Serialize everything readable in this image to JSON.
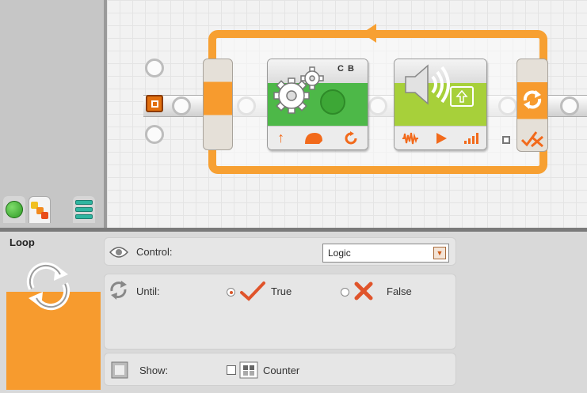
{
  "palette": {
    "tabs": [
      {
        "name": "common-palette",
        "icon": "green-circle-icon"
      },
      {
        "name": "complete-palette",
        "icon": "colored-squares-icon"
      },
      {
        "name": "custom-palette",
        "icon": "stacked-bars-icon"
      }
    ]
  },
  "canvas": {
    "motor_block": {
      "ports": "C B",
      "icon": "gears-icon"
    },
    "sound_block": {
      "icon": "speaker-icon"
    },
    "loop": {
      "icon": "loop-arrows-icon"
    }
  },
  "config": {
    "block_name": "Loop",
    "control": {
      "label": "Control:",
      "value": "Logic",
      "icon": "eye-icon"
    },
    "until": {
      "label": "Until:",
      "true_label": "True",
      "false_label": "False",
      "selected": "True",
      "icon": "loop-arrows-icon"
    },
    "show": {
      "label": "Show:",
      "counter_label": "Counter",
      "counter_checked": false,
      "icon": "counter-icon"
    }
  },
  "colors": {
    "loop_orange": "#f79b2e",
    "motor_green": "#4db848",
    "sound_lime": "#a7d03a",
    "accent_red": "#f26a1b"
  }
}
